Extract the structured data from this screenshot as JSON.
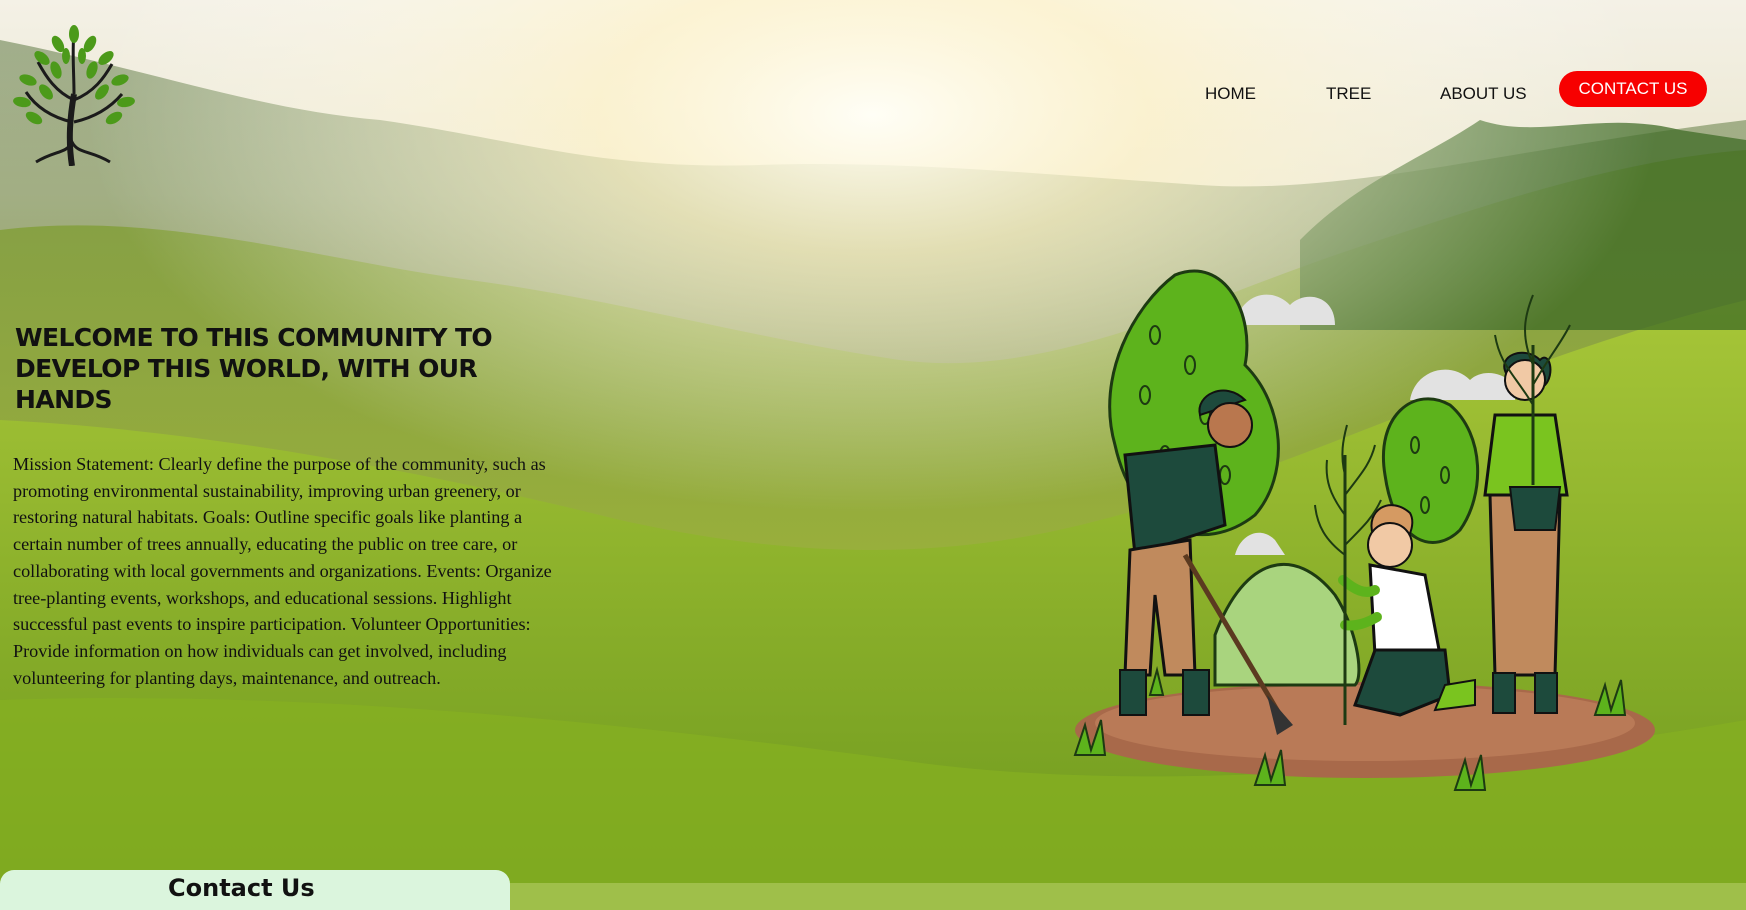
{
  "nav": {
    "home": "HOME",
    "tree": "TREE",
    "about": "ABOUT US",
    "contact": "CONTACT US"
  },
  "hero": {
    "title": "WELCOME TO THIS COMMUNITY TO DEVELOP THIS WORLD, WITH OUR HANDS",
    "description": "Mission Statement: Clearly define the purpose of the community, such as promoting environmental sustainability, improving urban greenery, or restoring natural habitats. Goals: Outline specific goals like planting a certain number of trees annually, educating the public on tree care, or collaborating with local governments and organizations. Events: Organize tree-planting events, workshops, and educational sessions. Highlight successful past events to inspire participation. Volunteer Opportunities: Provide information on how individuals can get involved, including volunteering for planting days, maintenance, and outreach."
  },
  "contact_section": {
    "title": "Contact Us"
  },
  "icons": {
    "logo": "tree-logo",
    "illustration": "people-planting-trees-illustration"
  },
  "colors": {
    "contact_button": "#f70000",
    "contact_strip": "#dbf5dd"
  }
}
